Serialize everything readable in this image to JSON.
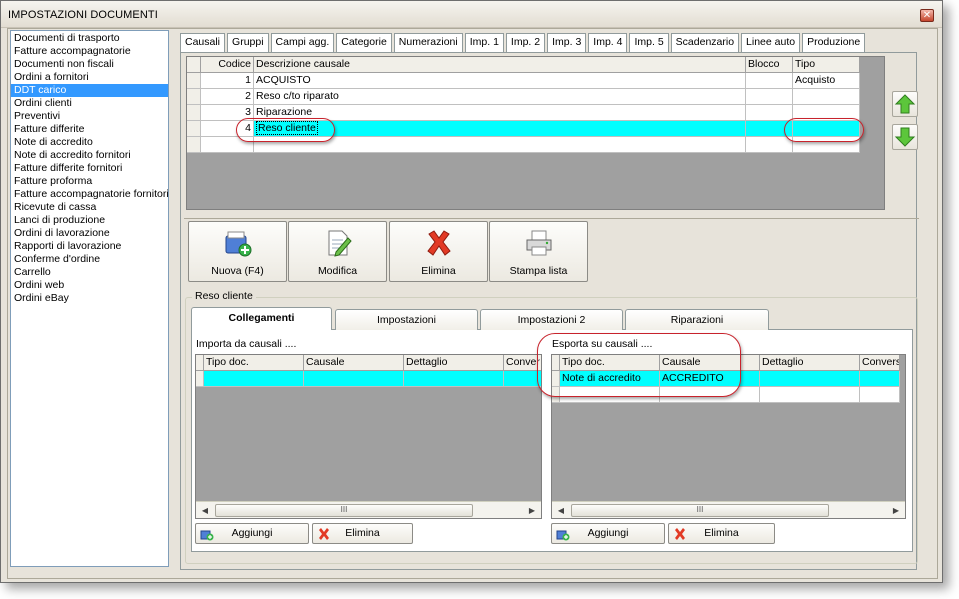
{
  "window": {
    "title": "IMPOSTAZIONI DOCUMENTI"
  },
  "doc_list": [
    "Documenti di trasporto",
    "Fatture accompagnatorie",
    "Documenti non fiscali",
    "Ordini a fornitori",
    "DDT carico",
    "Ordini clienti",
    "Preventivi",
    "Fatture differite",
    "Note di accredito",
    "Note di accredito fornitori",
    "Fatture differite fornitori",
    "Fatture proforma",
    "Fatture accompagnatorie fornitori",
    "Ricevute di cassa",
    "Lanci di produzione",
    "Ordini di lavorazione",
    "Rapporti di lavorazione",
    "Conferme d'ordine",
    "Carrello",
    "Ordini web",
    "Ordini eBay"
  ],
  "doc_list_selected": "DDT carico",
  "top_tabs": [
    "Causali",
    "Gruppi",
    "Campi agg.",
    "Categorie",
    "Numerazioni",
    "Imp. 1",
    "Imp. 2",
    "Imp. 3",
    "Imp. 4",
    "Imp. 5",
    "Scadenzario",
    "Linee auto",
    "Produzione"
  ],
  "causali": {
    "headers": {
      "codice": "Codice",
      "descrizione": "Descrizione causale",
      "blocco": "Blocco",
      "tipo": "Tipo"
    },
    "rows": [
      {
        "codice": "1",
        "descrizione": "ACQUISTO",
        "blocco": "",
        "tipo": "Acquisto"
      },
      {
        "codice": "2",
        "descrizione": "Reso c/to riparato",
        "blocco": "",
        "tipo": ""
      },
      {
        "codice": "3",
        "descrizione": "Riparazione",
        "blocco": "",
        "tipo": ""
      },
      {
        "codice": "4",
        "descrizione": "Reso cliente",
        "blocco": "",
        "tipo": ""
      }
    ]
  },
  "arrows": {
    "up": "arrow-up-icon",
    "down": "arrow-down-icon"
  },
  "toolbar": {
    "new_label": "Nuova (F4)",
    "edit_label": "Modifica",
    "delete_label": "Elimina",
    "print_label": "Stampa lista"
  },
  "group_title": "Reso cliente",
  "sub_tabs": [
    "Collegamenti",
    "Impostazioni",
    "Impostazioni 2",
    "Riparazioni"
  ],
  "import": {
    "label": "Importa da causali ....",
    "headers": [
      "Tipo doc.",
      "Causale",
      "Dettaglio",
      "Conver"
    ],
    "rows": [
      [
        "",
        "",
        "",
        ""
      ]
    ],
    "scroll_mark": "III",
    "add_label": "Aggiungi",
    "delete_label": "Elimina"
  },
  "export": {
    "label": "Esporta su causali ....",
    "headers": [
      "Tipo doc.",
      "Causale",
      "Dettaglio",
      "Conversi"
    ],
    "rows": [
      [
        "Note di accredito",
        "ACCREDITO",
        "",
        ""
      ]
    ],
    "scroll_mark": "III",
    "add_label": "Aggiungi",
    "delete_label": "Elimina"
  },
  "colors": {
    "selection": "#00ffff",
    "list_selection": "#3399ff",
    "highlight": "#c8232c"
  }
}
